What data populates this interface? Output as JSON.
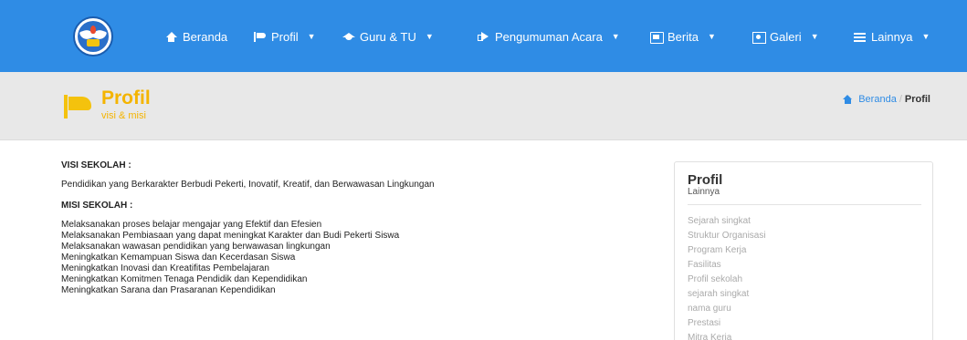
{
  "nav": {
    "items": [
      {
        "label": "Beranda",
        "icon": "home-icon",
        "dropdown": false
      },
      {
        "label": "Profil",
        "icon": "flag-icon",
        "dropdown": true
      },
      {
        "label": "Guru & TU",
        "icon": "graduation-cap-icon",
        "dropdown": true
      },
      {
        "label": "Pengumuman Acara",
        "icon": "bullhorn-icon",
        "dropdown": true
      },
      {
        "label": "Berita",
        "icon": "newspaper-icon",
        "dropdown": true
      },
      {
        "label": "Galeri",
        "icon": "photo-icon",
        "dropdown": true
      },
      {
        "label": "Lainnya",
        "icon": "list-icon",
        "dropdown": true
      }
    ],
    "color": "#2f8ce5"
  },
  "page_header": {
    "title": "Profil",
    "subtitle": "visi & misi",
    "accent_color": "#f4b400",
    "breadcrumb": {
      "home": "Beranda",
      "separator": "/",
      "current": "Profil"
    }
  },
  "content": {
    "visi_heading": "VISI SEKOLAH :",
    "visi_text": "Pendidikan yang Berkarakter Berbudi Pekerti, Inovatif, Kreatif, dan Berwawasan Lingkungan",
    "misi_heading": "MISI SEKOLAH :",
    "misi_items": [
      "Melaksanakan proses belajar mengajar yang Efektif dan Efesien",
      "Melaksanakan Pembiasaan yang dapat meningkat Karakter dan Budi Pekerti Siswa",
      "Melaksanakan wawasan pendidikan yang berwawasan lingkungan",
      "Meningkatkan Kemampuan Siswa dan Kecerdasan Siswa",
      "Meningkatkan Inovasi dan Kreatifitas Pembelajaran",
      "Meningkatkan Komitmen Tenaga Pendidik dan Kependidikan",
      "Meningkatkan Sarana dan Prasaranan Kependidikan"
    ]
  },
  "sidebar": {
    "title": "Profil",
    "subtitle": "Lainnya",
    "links": [
      "Sejarah singkat",
      "Struktur Organisasi",
      "Program Kerja",
      "Fasilitas",
      "Profil sekolah",
      "sejarah singkat",
      "nama guru",
      "Prestasi",
      "Mitra Kerja"
    ]
  }
}
